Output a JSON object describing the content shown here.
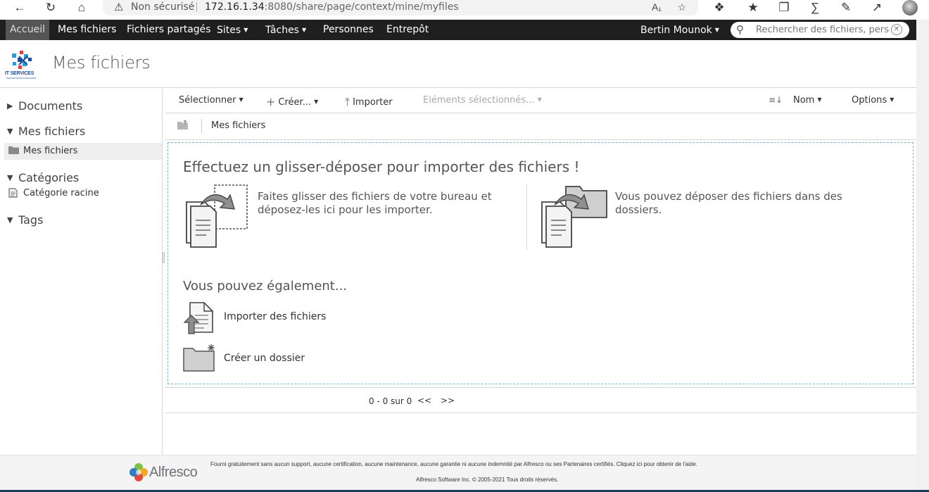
{
  "browser": {
    "security_label": "Non sécurisé",
    "url_host": "172.16.1.34",
    "url_rest": ":8080/share/page/context/mine/myfiles"
  },
  "nav": {
    "home": "Accueil",
    "my_files": "Mes fichiers",
    "shared_files": "Fichiers partagés",
    "sites": "Sites",
    "tasks": "Tâches",
    "people": "Personnes",
    "repository": "Entrepôt",
    "user": "Bertin Mounok"
  },
  "search": {
    "placeholder": "Rechercher des fichiers, personnes, sites"
  },
  "logo": {
    "text": "IT SERVICES",
    "subtext": "INNOVATIVE TECHNOLOGIES"
  },
  "page": {
    "title": "Mes fichiers"
  },
  "sidebar": {
    "documents": "Documents",
    "my_files": "Mes fichiers",
    "my_files_item": "Mes fichiers",
    "categories": "Catégories",
    "root_category": "Catégorie racine",
    "tags": "Tags"
  },
  "toolbar": {
    "select": "Sélectionner",
    "create": "Créer...",
    "import": "Importer",
    "selected_items": "Eléments sélectionnés...",
    "sort_field": "Nom",
    "options": "Options"
  },
  "breadcrumb": {
    "current": "Mes fichiers"
  },
  "dropzone": {
    "title": "Effectuez un glisser-déposer pour importer des fichiers !",
    "left_line1": "Faites glisser des fichiers de votre bureau et",
    "left_line2": "déposez-les ici pour les importer.",
    "right_line1": "Vous pouvez déposer des fichiers dans des",
    "right_line2": "dossiers.",
    "also": "Vous pouvez également...",
    "action_import": "Importer des fichiers",
    "action_create_folder": "Créer un dossier"
  },
  "pager": {
    "info": "0 - 0 sur 0",
    "prev": "<<",
    "next": ">>"
  },
  "footer": {
    "brand": "Alfresco",
    "line1": "Fourni gratuitement sans aucun support, aucune certification, aucune maintenance, aucune garantie ni aucune indemnité par Alfresco ou ses Partenaires certifiés. Cliquez ici pour obtenir de l'aide.",
    "line2": "Alfresco Software Inc. © 2005-2021 Tous droits réservés."
  },
  "colors": {
    "header_bg": "#1f1f1f",
    "dropzone_border": "#78b8d6",
    "footer_bg": "#f4f4f4"
  }
}
